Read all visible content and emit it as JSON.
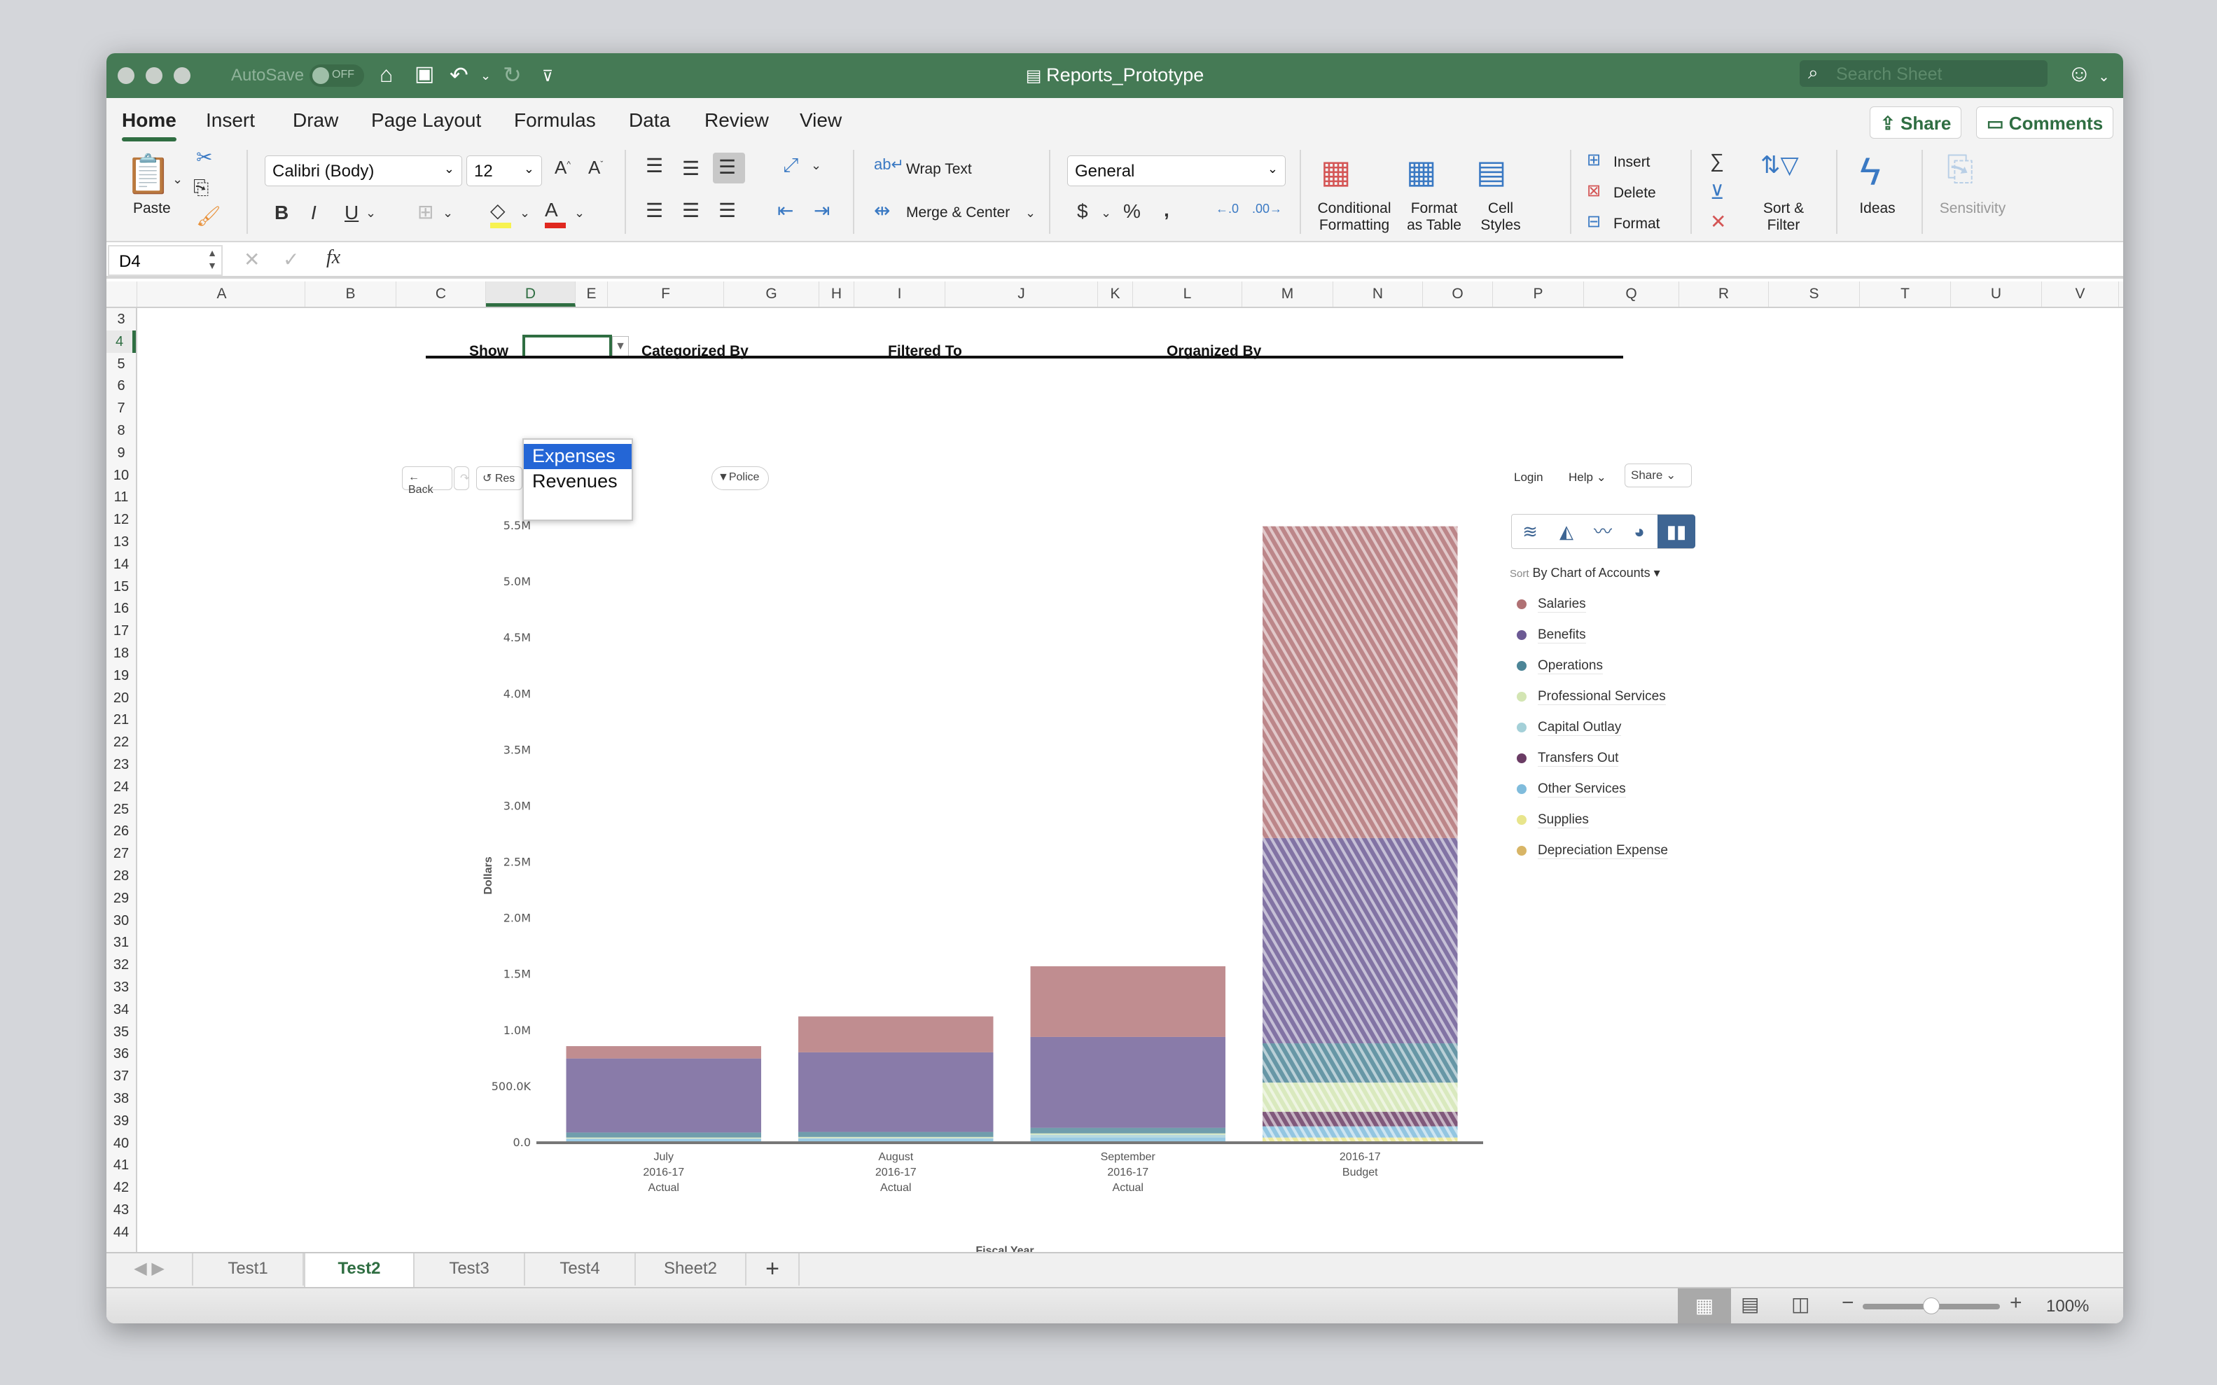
{
  "window": {
    "title": "Reports_Prototype",
    "autosave_label": "AutoSave",
    "autosave_state": "OFF",
    "search_placeholder": "Search Sheet"
  },
  "ribbon_tabs": [
    "Home",
    "Insert",
    "Draw",
    "Page Layout",
    "Formulas",
    "Data",
    "Review",
    "View"
  ],
  "active_tab": "Home",
  "header_buttons": {
    "share": "Share",
    "comments": "Comments"
  },
  "ribbon": {
    "paste": "Paste",
    "font_name": "Calibri (Body)",
    "font_size": "12",
    "wrap_text": "Wrap Text",
    "merge_center": "Merge & Center",
    "number_format": "General",
    "conditional_formatting": [
      "Conditional",
      "Formatting"
    ],
    "format_as_table": [
      "Format",
      "as Table"
    ],
    "cell_styles": [
      "Cell",
      "Styles"
    ],
    "insert": "Insert",
    "delete": "Delete",
    "format": "Format",
    "sort_filter": [
      "Sort &",
      "Filter"
    ],
    "ideas": "Ideas",
    "sensitivity": "Sensitivity",
    "colors": {
      "highlight": "#f7f250",
      "font_color": "#e0281f",
      "accent": "#2f6e42"
    }
  },
  "formula_bar": {
    "name_box": "D4",
    "formula": "",
    "fx": "fx"
  },
  "columns": [
    "A",
    "B",
    "C",
    "D",
    "E",
    "F",
    "G",
    "H",
    "I",
    "J",
    "K",
    "L",
    "M",
    "N",
    "O",
    "P",
    "Q",
    "R",
    "S",
    "T",
    "U",
    "V"
  ],
  "selected_column": "D",
  "rows": [
    "3",
    "4",
    "5",
    "6",
    "7",
    "8",
    "9",
    "10",
    "11",
    "12",
    "13",
    "14",
    "15",
    "16",
    "17",
    "18",
    "19",
    "20",
    "21",
    "22",
    "23",
    "24",
    "25",
    "26",
    "27",
    "28",
    "29",
    "30",
    "31",
    "32",
    "33",
    "34",
    "35",
    "36",
    "37",
    "38",
    "39",
    "40",
    "41",
    "42",
    "43",
    "44"
  ],
  "sheet_header": {
    "show": "Show",
    "categorized_by": "Categorized By",
    "filtered_to": "Filtered To",
    "organized_by": "Organized By"
  },
  "dropdown": {
    "options": [
      "Expenses",
      "Revenues"
    ],
    "highlighted": "Expenses"
  },
  "embed_toolbar": {
    "back": "← Back",
    "reset": "↺ Res",
    "filter_chip": "Police",
    "login": "Login",
    "help": "Help ⌄",
    "share": "Share ⌄",
    "sort_prefix": "Sort",
    "sort_value": "By Chart of Accounts ▾",
    "chart_types": [
      "stacked-area",
      "area",
      "line",
      "pie",
      "bar"
    ],
    "active_chart_type": "bar"
  },
  "chart_data": {
    "type": "bar",
    "stacked": true,
    "title": "",
    "xlabel": "Fiscal Year",
    "ylabel": "Dollars",
    "ylim": [
      0,
      5500000
    ],
    "yticks": [
      0,
      500000,
      1000000,
      1500000,
      2000000,
      2500000,
      3000000,
      3500000,
      4000000,
      4500000,
      5000000,
      5500000
    ],
    "ytick_labels": [
      "0.0",
      "500.0K",
      "1.0M",
      "1.5M",
      "2.0M",
      "2.5M",
      "3.0M",
      "3.5M",
      "4.0M",
      "4.5M",
      "5.0M",
      "5.5M"
    ],
    "categories": [
      [
        "July",
        "2016-17",
        "Actual"
      ],
      [
        "August",
        "2016-17",
        "Actual"
      ],
      [
        "September",
        "2016-17",
        "Actual"
      ],
      [
        "2016-17",
        "Budget"
      ]
    ],
    "hatched_categories": [
      3
    ],
    "legend_position": "right",
    "series": [
      {
        "name": "Salaries",
        "color": "#b07174",
        "values": [
          110000,
          320000,
          630000,
          2780000
        ]
      },
      {
        "name": "Benefits",
        "color": "#6c5a94",
        "values": [
          660000,
          710000,
          810000,
          1830000
        ]
      },
      {
        "name": "Operations",
        "color": "#4c8597",
        "values": [
          45000,
          45000,
          50000,
          350000
        ]
      },
      {
        "name": "Professional Services",
        "color": "#d3e5b3",
        "values": [
          8000,
          10000,
          12000,
          260000
        ]
      },
      {
        "name": "Capital Outlay",
        "color": "#a4d0d8",
        "values": [
          5000,
          5000,
          25000,
          0
        ]
      },
      {
        "name": "Transfers Out",
        "color": "#6a3c64",
        "values": [
          0,
          0,
          0,
          130000
        ]
      },
      {
        "name": "Other Services",
        "color": "#80bcdc",
        "values": [
          27000,
          30000,
          40000,
          100000
        ]
      },
      {
        "name": "Supplies",
        "color": "#e8e58c",
        "values": [
          0,
          0,
          0,
          40000
        ]
      },
      {
        "name": "Depreciation Expense",
        "color": "#d8b566",
        "values": [
          0,
          0,
          0,
          0
        ]
      }
    ]
  },
  "sheet_tabs": [
    "Test1",
    "Test2",
    "Test3",
    "Test4",
    "Sheet2"
  ],
  "active_sheet": "Test2",
  "status_bar": {
    "zoom": "100%",
    "zoom_fraction": 0.5
  }
}
